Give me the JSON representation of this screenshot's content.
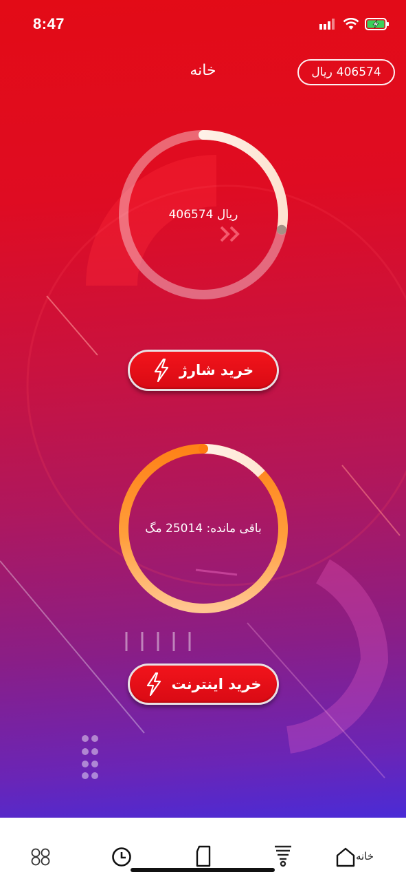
{
  "status_bar": {
    "time": "8:47"
  },
  "header": {
    "title": "خانه",
    "balance_amount": "406574",
    "balance_unit": "ریال"
  },
  "charge_card": {
    "amount": "406574",
    "unit": "ریال",
    "progress": 0.28,
    "button_label": "خرید شارژ"
  },
  "internet_card": {
    "label": "باقی مانده:",
    "amount": "25014",
    "unit": "مگ",
    "progress": 0.13,
    "button_label": "خرید اینترنت"
  },
  "bottom_nav": {
    "home_label": "خانه"
  },
  "colors": {
    "accent_red": "#e30b16",
    "orange": "#ff8a1c",
    "purple": "#4a2bd6"
  }
}
